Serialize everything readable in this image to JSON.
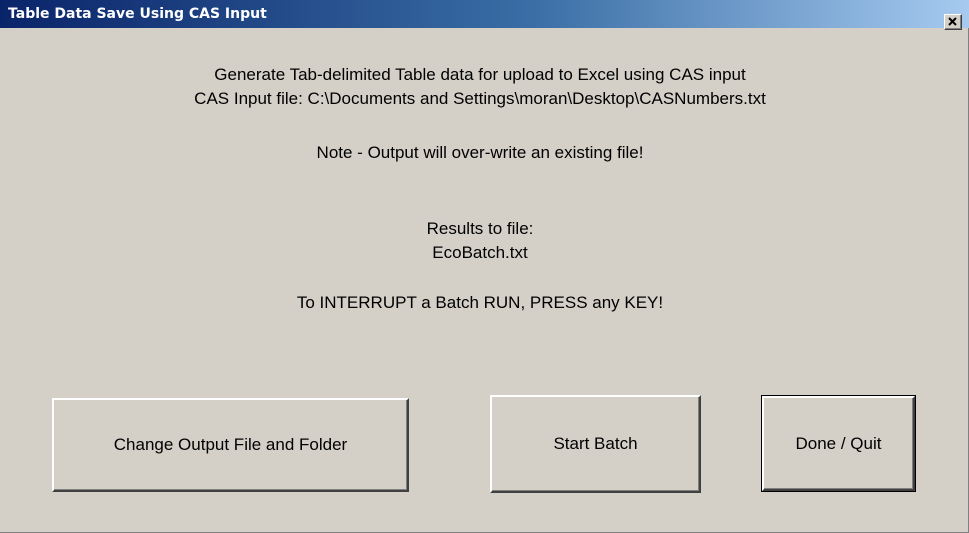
{
  "window": {
    "title": "Table Data Save Using CAS Input",
    "close_glyph": "×"
  },
  "content": {
    "line1": "Generate Tab-delimited Table data for upload to Excel using CAS input",
    "line2": "CAS Input file:  C:\\Documents and Settings\\moran\\Desktop\\CASNumbers.txt",
    "note": "Note - Output will over-write an existing file!",
    "results_label": "Results to file:",
    "results_file": "EcoBatch.txt",
    "interrupt": "To INTERRUPT a Batch RUN, PRESS any KEY!"
  },
  "buttons": {
    "change_output": "Change Output File and Folder",
    "start_batch": "Start Batch",
    "done_quit": "Done / Quit"
  },
  "colors": {
    "face": "#d4d0c8",
    "title_start": "#0a246a",
    "title_end": "#a6caf0"
  }
}
